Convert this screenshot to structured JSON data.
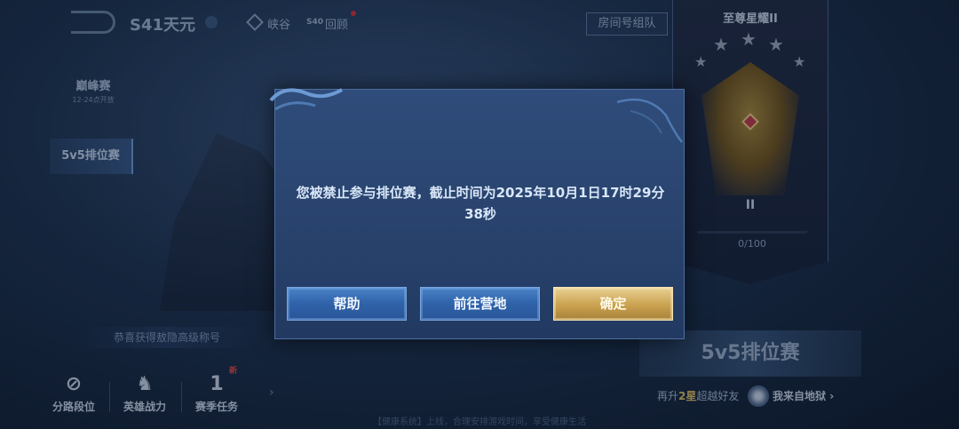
{
  "header": {
    "season_label": "S41天元",
    "gorge_label": "峡谷",
    "s40_tag": "S40",
    "review_label": "回顾",
    "room_button": "房间号组队"
  },
  "left_menu": {
    "peak_title": "巅峰赛",
    "peak_schedule": "12-24点开放",
    "ranked_label": "5v5排位赛",
    "congrats_text": "恭喜获得敖隐高级称号"
  },
  "bottom_stats": {
    "lane_rank_label": "分路段位",
    "hero_power_label": "英雄战力",
    "season_task_count": "1",
    "season_task_label": "赛季任务",
    "new_badge": "新"
  },
  "footer": {
    "health_tip": "【健康系统】上线，合理安排游戏时间，享受健康生活"
  },
  "rank_panel": {
    "rank_name": "至尊星耀II",
    "tier_numeral": "II",
    "stars_earned": 3,
    "progress_text": "0/100",
    "progress_value": 0,
    "ranked_title": "5v5排位赛",
    "promo_prefix": "再升",
    "promo_highlight": "2星",
    "promo_suffix": "超越好友",
    "friend_name": "我来自地狱"
  },
  "modal": {
    "message": "您被禁止参与排位赛，截止时间为2025年10月1日17时29分38秒",
    "help_button": "帮助",
    "camp_button": "前往营地",
    "confirm_button": "确定"
  },
  "colors": {
    "modal_bg": "#2f4c7a",
    "button_blue": "#2f62a8",
    "button_gold": "#c9a14f",
    "alert_red": "#d6343c",
    "highlight_gold": "#e2c063"
  }
}
